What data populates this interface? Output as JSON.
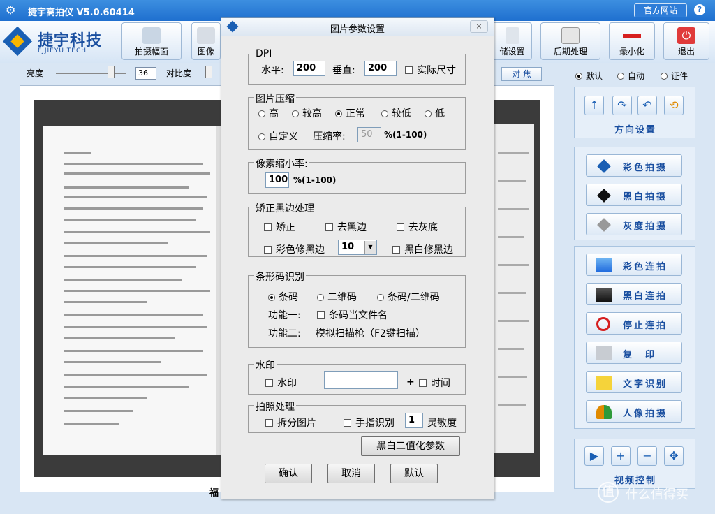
{
  "app": {
    "title": "捷宇高拍仪 V5.0.60414",
    "official_site": "官方网站",
    "help": "?"
  },
  "logo": {
    "name": "捷宇科技",
    "sub": "FJJIEYU TECH"
  },
  "toolbar": {
    "capture": "拍摄幅面",
    "image": "图像",
    "storage": "储设置",
    "post": "后期处理",
    "minimize": "最小化",
    "exit": "退出"
  },
  "adjust": {
    "brightness_label": "亮度",
    "brightness_value": "36",
    "contrast_label": "对比度",
    "focus_button": "对 焦"
  },
  "modes": {
    "default": "默认",
    "auto": "自动",
    "id": "证件",
    "selected": "默认"
  },
  "orientation": {
    "title": "方向设置"
  },
  "capture_buttons": {
    "color": "彩色拍摄",
    "bw": "黑白拍摄",
    "gray": "灰度拍摄"
  },
  "continuous": {
    "color": "彩色连拍",
    "bw": "黑白连拍",
    "stop": "停止连拍",
    "copy": "复　印",
    "ocr": "文字识别",
    "portrait": "人像拍摄"
  },
  "video": {
    "title": "视频控制"
  },
  "preview": {
    "bottom_char": "福"
  },
  "dialog": {
    "title": "图片参数设置",
    "close": "×",
    "dpi": {
      "legend": "DPI",
      "h_label": "水平:",
      "h_value": "200",
      "v_label": "垂直:",
      "v_value": "200",
      "actual": "实际尺寸"
    },
    "compress": {
      "legend": "图片压缩",
      "options": [
        "高",
        "较高",
        "正常",
        "较低",
        "低"
      ],
      "selected": "正常",
      "custom": "自定义",
      "rate_label": "压缩率:",
      "rate_value": "50",
      "rate_unit": "%(1-100)"
    },
    "scale": {
      "legend": "像素缩小率:",
      "value": "100",
      "unit": "%(1-100)"
    },
    "correct": {
      "legend": "矫正黑边处理",
      "deskew": "矫正",
      "remove_black": "去黑边",
      "remove_gray": "去灰底",
      "color_fix": "彩色修黑边",
      "color_fix_value": "10",
      "bw_fix": "黑白修黑边"
    },
    "barcode": {
      "legend": "条形码识别",
      "opt1": "条码",
      "opt2": "二维码",
      "opt3": "条码/二维码",
      "selected": "条码",
      "func1_label": "功能一:",
      "func1": "条码当文件名",
      "func2_label": "功能二:",
      "func2": "模拟扫描枪（F2键扫描）"
    },
    "watermark": {
      "legend": "水印",
      "check": "水印",
      "text": "",
      "plus": "+",
      "time": "时间"
    },
    "photo": {
      "legend": "拍照处理",
      "split": "拆分图片",
      "finger": "手指识别",
      "sensitivity_value": "1",
      "sensitivity_label": "灵敏度"
    },
    "bw_params": "黑白二值化参数",
    "ok": "确认",
    "cancel": "取消",
    "default": "默认"
  },
  "watermark_site": {
    "logo": "值",
    "text": "什么值得买"
  }
}
